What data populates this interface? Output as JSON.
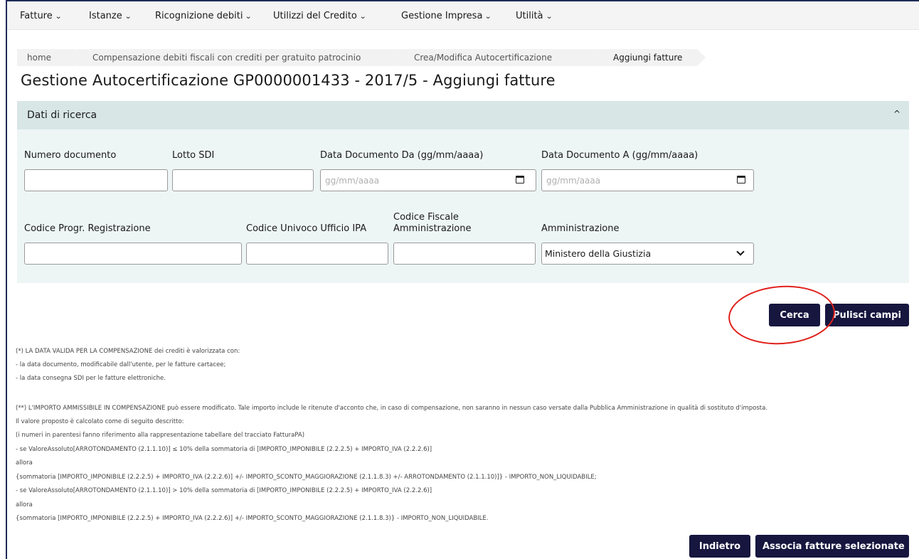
{
  "menu": [
    {
      "label": "Fatture",
      "chevron": "⌄"
    },
    {
      "label": "Istanze",
      "chevron": "⌄"
    },
    {
      "label": "Ricognizione debiti",
      "chevron": "⌄"
    },
    {
      "label": "Utilizzi del Credito",
      "chevron": "⌄"
    },
    {
      "label": "Gestione Impresa",
      "chevron": "⌄"
    },
    {
      "label": "Utilità",
      "chevron": "⌄"
    }
  ],
  "breadcrumb": [
    "home",
    "Compensazione debiti fiscali con crediti per gratuito patrocinio",
    "Crea/Modifica Autocertificazione",
    "Aggiungi fatture"
  ],
  "page_title": "Gestione Autocertificazione GP0000001433 - 2017/5 - Aggiungi fatture",
  "search_panel": {
    "title": "Dati di ricerca",
    "toggle_icon": "^",
    "fields": {
      "numero_documento": {
        "label": "Numero documento",
        "value": ""
      },
      "lotto_sdi": {
        "label": "Lotto SDI",
        "value": ""
      },
      "data_da": {
        "label": "Data Documento Da (gg/mm/aaaa)",
        "placeholder": "gg/mm/aaaa",
        "value": ""
      },
      "data_a": {
        "label": "Data Documento A (gg/mm/aaaa)",
        "placeholder": "gg/mm/aaaa",
        "value": ""
      },
      "codice_progr": {
        "label": "Codice Progr. Registrazione",
        "value": ""
      },
      "codice_ipa": {
        "label": "Codice Univoco Ufficio IPA",
        "value": ""
      },
      "codice_fiscale_line1": "Codice Fiscale",
      "codice_fiscale_line2": "Amministrazione",
      "codice_fiscale": {
        "value": ""
      },
      "amministrazione": {
        "label": "Amministrazione",
        "selected": "Ministero della Giustizia"
      }
    }
  },
  "buttons": {
    "cerca": "Cerca",
    "pulisci": "Pulisci campi",
    "indietro": "Indietro",
    "associa": "Associa fatture selezionate"
  },
  "notes": [
    "(*) LA DATA VALIDA PER LA COMPENSAZIONE dei crediti è valorizzata con:",
    "- la data documento, modificabile dall'utente, per le fatture cartacee;",
    "- la data consegna SDI per le fatture elettroniche.",
    "(**) L'IMPORTO AMMISSIBILE IN COMPENSAZIONE può essere modificato. Tale importo include le ritenute d'acconto che, in caso di compensazione, non saranno in nessun caso versate dalla Pubblica Amministrazione in qualità di sostituto d'imposta.",
    "Il valore proposto è calcolato come di seguito descritto:",
    "(i numeri in parentesi fanno riferimento alla rappresentazione tabellare del tracciato FatturaPA)",
    "- se ValoreAssoluto[ARROTONDAMENTO (2.1.1.10)] ≤ 10% della sommatoria di [IMPORTO_IMPONIBILE (2.2.2.5) + IMPORTO_IVA (2.2.2.6)]",
    "allora",
    "{sommatoria [IMPORTO_IMPONIBILE (2.2.2.5) + IMPORTO_IVA (2.2.2.6)] +/- IMPORTO_SCONTO_MAGGIORAZIONE (2.1.1.8.3) +/- ARROTONDAMENTO (2.1.1.10)]} - IMPORTO_NON_LIQUIDABILE;",
    "- se ValoreAssoluto[ARROTONDAMENTO (2.1.1.10)] > 10% della sommatoria di [IMPORTO_IMPONIBILE (2.2.2.5) + IMPORTO_IVA (2.2.2.6)]",
    "allora",
    "{sommatoria [IMPORTO_IMPONIBILE (2.2.2.5) + IMPORTO_IVA (2.2.2.6)] +/- IMPORTO_SCONTO_MAGGIORAZIONE (2.1.1.8.3)} - IMPORTO_NON_LIQUIDABILE."
  ],
  "colors": {
    "primary_button": "#16163f",
    "panel_bg": "#eef5f5",
    "panel_header_bg": "#d8e6e6",
    "annotation_circle": "#e0201b"
  }
}
